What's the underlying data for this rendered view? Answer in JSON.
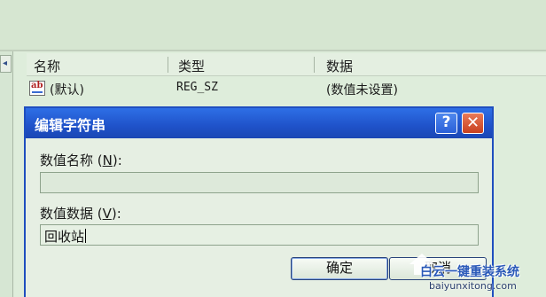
{
  "list": {
    "columns": [
      "名称",
      "类型",
      "数据"
    ],
    "rows": [
      {
        "name": "(默认)",
        "type": "REG_SZ",
        "data": "(数值未设置)",
        "icon": "ab-string-icon"
      }
    ]
  },
  "dialog": {
    "title": "编辑字符串",
    "help_label": "?",
    "close_label": "✕",
    "name_label_pre": "数值名称 (",
    "name_label_key": "N",
    "name_label_post": "):",
    "name_value": "",
    "data_label_pre": "数值数据 (",
    "data_label_key": "V",
    "data_label_post": "):",
    "data_value": "回收站",
    "ok_label": "确定",
    "cancel_label": "取消"
  },
  "watermark": {
    "text": "白云一键重装系统",
    "url": "baiyunxitong.com"
  },
  "colors": {
    "titlebar": "#1f52c9",
    "close": "#c8401f",
    "background": "#d9e8d6"
  }
}
